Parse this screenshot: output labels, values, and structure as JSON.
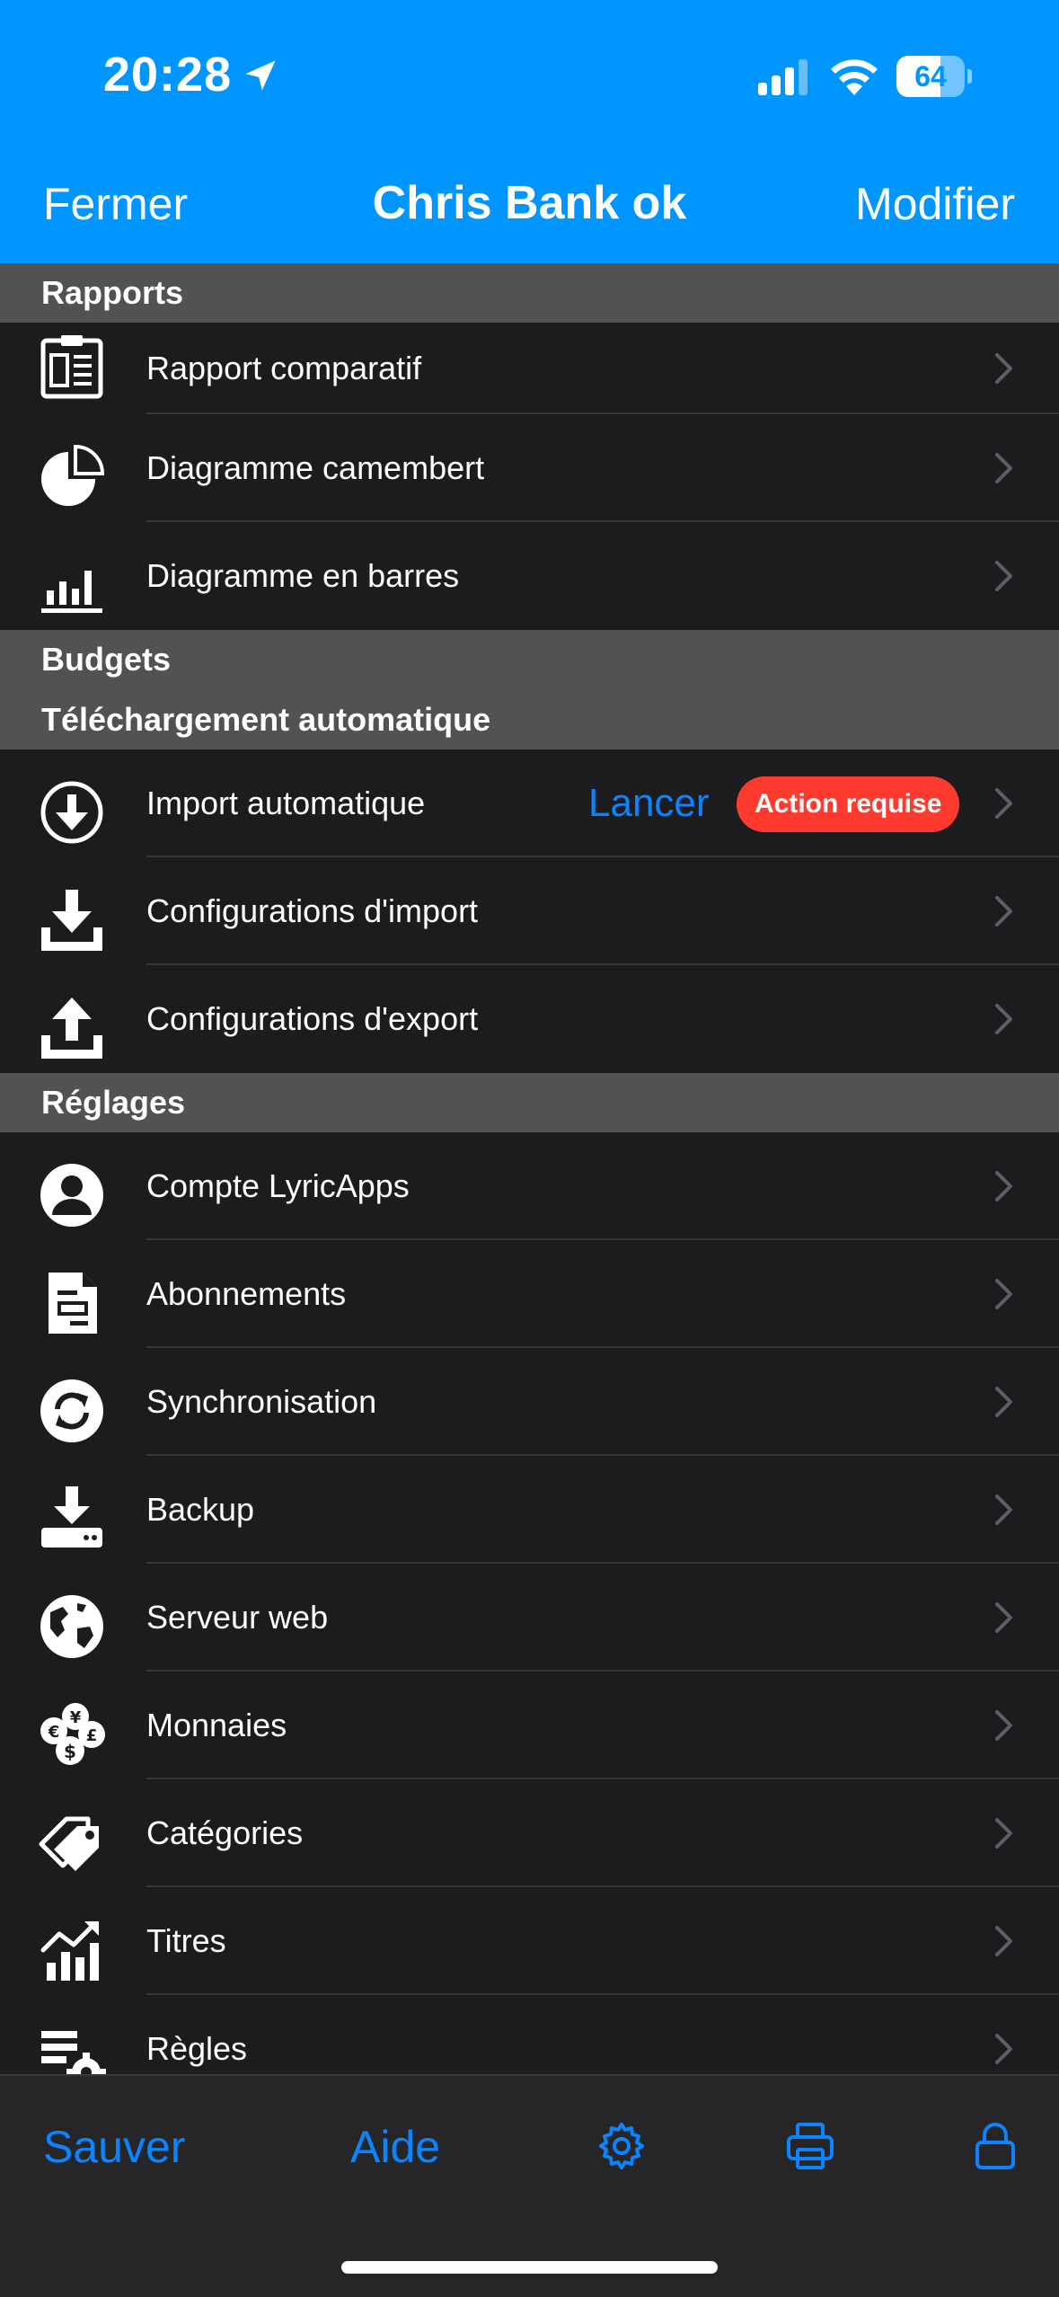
{
  "status_bar": {
    "time": "20:28",
    "battery_percent": "64",
    "battery_level": 0.64
  },
  "nav": {
    "left": "Fermer",
    "title": "Chris Bank ok",
    "right": "Modifier"
  },
  "colors": {
    "accent": "#0096ff",
    "tint": "#0a84ff",
    "badge": "#ff3b30",
    "background": "#1c1c1e",
    "section_header": "#525255"
  },
  "sections": {
    "rapports": {
      "title": "Rapports",
      "items": [
        {
          "label": "Rapport comparatif",
          "icon": "clipboard-report-icon"
        },
        {
          "label": "Diagramme camembert",
          "icon": "pie-chart-icon"
        },
        {
          "label": "Diagramme en barres",
          "icon": "bar-chart-icon"
        }
      ]
    },
    "budgets": {
      "title": "Budgets"
    },
    "telechargement": {
      "title": "Téléchargement automatique",
      "items": [
        {
          "label": "Import automatique",
          "icon": "download-circle-icon",
          "action": "Lancer",
          "badge": "Action requise"
        },
        {
          "label": "Configurations d'import",
          "icon": "import-tray-icon"
        },
        {
          "label": "Configurations d'export",
          "icon": "export-tray-icon"
        }
      ]
    },
    "reglages": {
      "title": "Réglages",
      "items": [
        {
          "label": "Compte LyricApps",
          "icon": "user-account-icon"
        },
        {
          "label": "Abonnements",
          "icon": "subscription-document-icon"
        },
        {
          "label": "Synchronisation",
          "icon": "sync-icon"
        },
        {
          "label": "Backup",
          "icon": "backup-drive-icon"
        },
        {
          "label": "Serveur web",
          "icon": "globe-icon"
        },
        {
          "label": "Monnaies",
          "icon": "currencies-icon"
        },
        {
          "label": "Catégories",
          "icon": "tags-icon"
        },
        {
          "label": "Titres",
          "icon": "stocks-chart-icon"
        },
        {
          "label": "Règles",
          "icon": "rules-gear-icon"
        }
      ]
    }
  },
  "tabbar": {
    "save": "Sauver",
    "help": "Aide",
    "settings_icon": "gear-icon",
    "print_icon": "printer-icon",
    "lock_icon": "lock-icon"
  }
}
